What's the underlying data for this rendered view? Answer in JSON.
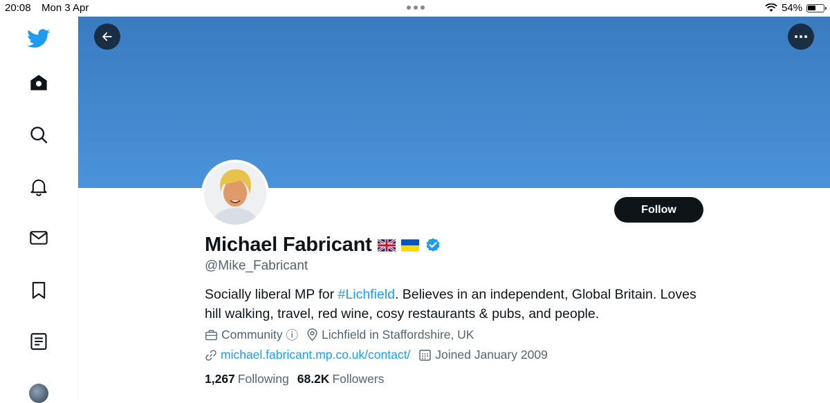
{
  "status_bar": {
    "time": "20:08",
    "date": "Mon 3 Apr",
    "battery": "54%",
    "battery_level": 0.54
  },
  "sidebar": {
    "items": [
      {
        "icon": "twitter-bird-icon"
      },
      {
        "icon": "home-icon"
      },
      {
        "icon": "search-icon"
      },
      {
        "icon": "bell-icon"
      },
      {
        "icon": "mail-icon"
      },
      {
        "icon": "bookmark-icon"
      },
      {
        "icon": "list-icon"
      }
    ]
  },
  "colors": {
    "brand": "#1d9bf0",
    "banner": "#4a93da",
    "text": "#0f1419",
    "muted": "#536471"
  },
  "profile": {
    "name": "Michael Fabricant",
    "handle": "@Mike_Fabricant",
    "verified": true,
    "bio_prefix": "Socially liberal MP for ",
    "bio_hashtag": "#Lichfield",
    "bio_suffix": ". Believes in an independent, Global Britain. Loves hill walking, travel, red wine, cosy restaurants & pubs, and people.",
    "category": "Community",
    "category_info": "ⓘ",
    "location": "Lichfield in Staffordshire, UK",
    "website": "michael.fabricant.mp.co.uk/contact/",
    "joined": "Joined January 2009",
    "following_count": "1,267",
    "following_label": "Following",
    "followers_count": "68.2K",
    "followers_label": "Followers"
  },
  "actions": {
    "follow_label": "Follow"
  }
}
